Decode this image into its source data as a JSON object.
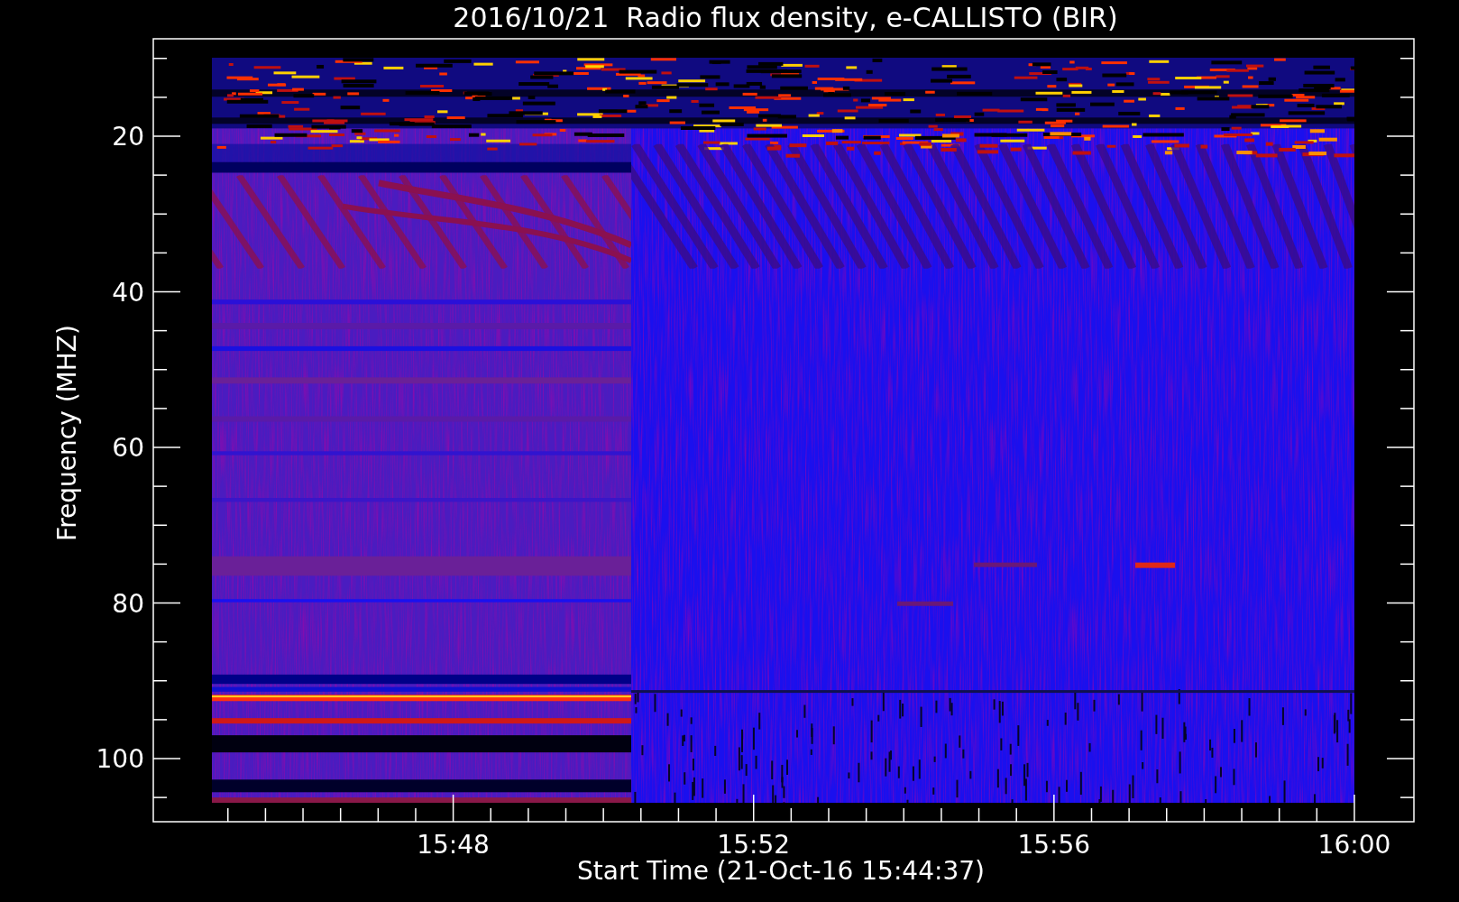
{
  "title": "2016/10/21  Radio flux density, e-CALLISTO (BIR)",
  "y_axis": {
    "label": "Frequency (MHZ)",
    "ticks": [
      "20",
      "40",
      "60",
      "80",
      "100"
    ]
  },
  "x_axis": {
    "label": "Start Time (21-Oct-16 15:44:37)",
    "ticks": [
      "15:48",
      "15:52",
      "15:56",
      "16:00"
    ]
  }
}
